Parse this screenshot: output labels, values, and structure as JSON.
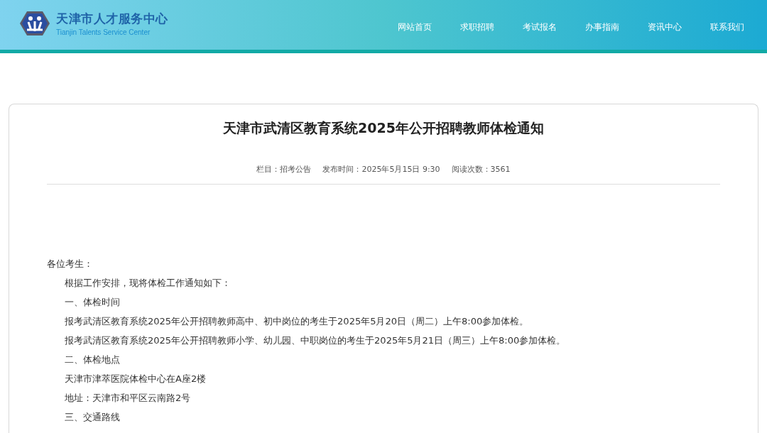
{
  "header": {
    "site_name": "天津市人才服务中心",
    "site_name_en": "Tianjin Talents Service Center",
    "nav": [
      {
        "label": "网站首页"
      },
      {
        "label": "求职招聘"
      },
      {
        "label": "考试报名"
      },
      {
        "label": "办事指南"
      },
      {
        "label": "资讯中心"
      },
      {
        "label": "联系我们"
      }
    ]
  },
  "article": {
    "title": "天津市武清区教育系统2025年公开招聘教师体检通知",
    "meta": [
      "栏目：招考公告",
      "发布时间：2025年5月15日 9:30",
      "阅读次数：3561"
    ],
    "paragraphs": [
      {
        "kind": "salutation",
        "text": "各位考生："
      },
      {
        "kind": "body",
        "text": "根据工作安排，现将体检工作通知如下："
      },
      {
        "kind": "body",
        "text": "一、体检时间"
      },
      {
        "kind": "body",
        "text": "报考武清区教育系统2025年公开招聘教师高中、初中岗位的考生于2025年5月20日（周二）上午8:00参加体检。"
      },
      {
        "kind": "body",
        "text": "报考武清区教育系统2025年公开招聘教师小学、幼儿园、中职岗位的考生于2025年5月21日（周三）上午8:00参加体检。"
      },
      {
        "kind": "body",
        "text": "二、体检地点"
      },
      {
        "kind": "body",
        "text": "天津市津萃医院体检中心在A座2楼"
      },
      {
        "kind": "body",
        "text": "地址：天津市和平区云南路2号"
      },
      {
        "kind": "body",
        "text": "三、交通路线"
      }
    ]
  }
}
